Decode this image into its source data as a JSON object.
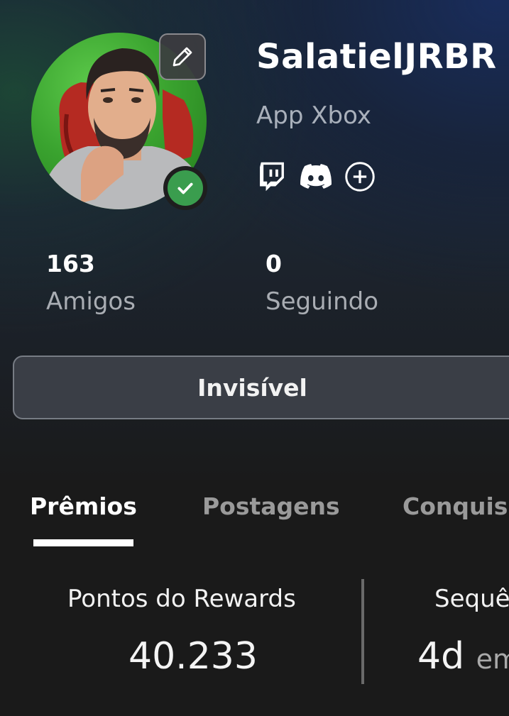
{
  "profile": {
    "username": "SalatielJRBR",
    "subtitle": "App Xbox",
    "online_status": "online",
    "social_icons": [
      "twitch-icon",
      "discord-icon",
      "add-circle-icon"
    ]
  },
  "stats": [
    {
      "value": "163",
      "label": "Amigos"
    },
    {
      "value": "0",
      "label": "Seguindo"
    }
  ],
  "status_button": {
    "label": "Invisível"
  },
  "tabs": [
    {
      "label": "Prêmios",
      "active": true
    },
    {
      "label": "Postagens",
      "active": false
    },
    {
      "label": "Conquis",
      "active": false
    }
  ],
  "rewards": {
    "points_label": "Pontos do Rewards",
    "points_value": "40.233",
    "streak_label": "Sequê",
    "streak_value": "4d",
    "streak_unit": "em"
  },
  "colors": {
    "online_green": "#3a9d4e",
    "avatar_background": "#3aa32f",
    "button_bg": "#3a3e46"
  }
}
